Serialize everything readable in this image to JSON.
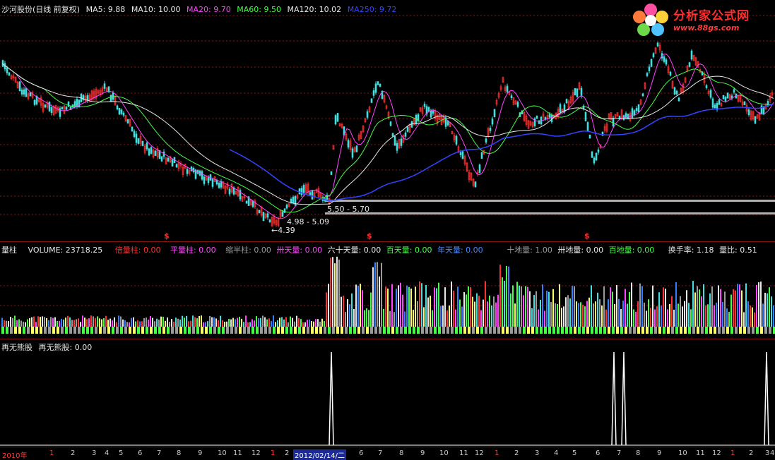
{
  "main": {
    "title": "沙河股份(日线 前复权)",
    "ma": [
      {
        "label": "MA5: 9.88",
        "color": "#e8e8e8"
      },
      {
        "label": "MA10: 10.00",
        "color": "#e8e8e8"
      },
      {
        "label": "MA20: 9.70",
        "color": "#ff44ff"
      },
      {
        "label": "MA60: 9.50",
        "color": "#44ff44"
      },
      {
        "label": "MA120: 10.02",
        "color": "#e8e8e8"
      },
      {
        "label": "MA250: 9.72",
        "color": "#3344ff"
      }
    ],
    "annotation_range_1": "5.50 - 5.70",
    "annotation_range_2": "4.98 - 5.09",
    "annotation_low": "←4.39",
    "dollar_mark": "$"
  },
  "volume": {
    "title": "量柱",
    "items": [
      {
        "label": "VOLUME: 23718.25",
        "color": "#e8e8e8"
      },
      {
        "label": "倍量柱: 0.00",
        "color": "#ff3030"
      },
      {
        "label": "平量柱: 0.00",
        "color": "#ff44ff"
      },
      {
        "label": "缩半柱: 0.00",
        "color": "#9a9a9a"
      },
      {
        "label": "卅天量: 0.00",
        "color": "#ff44ff"
      },
      {
        "label": "六十天量: 0.00",
        "color": "#e8e8e8"
      },
      {
        "label": "百天量: 0.00",
        "color": "#44ff44"
      },
      {
        "label": "年天量: 0.00",
        "color": "#4488ff"
      },
      {
        "label": "十地量: 1.00",
        "color": "#9a9a9a"
      },
      {
        "label": "卅地量: 0.00",
        "color": "#e8e8e8"
      },
      {
        "label": "百地量: 0.00",
        "color": "#44ff44"
      },
      {
        "label": "换手率: 1.18",
        "color": "#e8e8e8"
      },
      {
        "label": "量比: 0.51",
        "color": "#e8e8e8"
      }
    ]
  },
  "indicator": {
    "title": "再无熊股",
    "value_label": "再无熊股: 0.00"
  },
  "time_axis": [
    {
      "label": "2010年",
      "type": "red"
    },
    {
      "label": "1",
      "type": "red"
    },
    {
      "label": "2",
      "type": "normal"
    },
    {
      "label": "3",
      "type": "normal"
    },
    {
      "label": "4",
      "type": "normal"
    },
    {
      "label": "5",
      "type": "normal"
    },
    {
      "label": "6",
      "type": "normal"
    },
    {
      "label": "7",
      "type": "normal"
    },
    {
      "label": "8",
      "type": "normal"
    },
    {
      "label": "9",
      "type": "normal"
    },
    {
      "label": "10",
      "type": "normal"
    },
    {
      "label": "11",
      "type": "normal"
    },
    {
      "label": "12",
      "type": "normal"
    },
    {
      "label": "1",
      "type": "red"
    },
    {
      "label": "2",
      "type": "normal"
    },
    {
      "label": "2012/02/14/二",
      "type": "sel"
    },
    {
      "label": "6",
      "type": "normal"
    },
    {
      "label": "7",
      "type": "normal"
    },
    {
      "label": "8",
      "type": "normal"
    },
    {
      "label": "9",
      "type": "normal"
    },
    {
      "label": "10",
      "type": "normal"
    },
    {
      "label": "11",
      "type": "normal"
    },
    {
      "label": "12",
      "type": "normal"
    },
    {
      "label": "1",
      "type": "red"
    },
    {
      "label": "2",
      "type": "normal"
    },
    {
      "label": "3",
      "type": "normal"
    },
    {
      "label": "4",
      "type": "normal"
    },
    {
      "label": "5",
      "type": "normal"
    },
    {
      "label": "6",
      "type": "normal"
    },
    {
      "label": "7",
      "type": "normal"
    },
    {
      "label": "8",
      "type": "normal"
    },
    {
      "label": "9",
      "type": "normal"
    },
    {
      "label": "10",
      "type": "normal"
    },
    {
      "label": "11",
      "type": "normal"
    },
    {
      "label": "12",
      "type": "normal"
    },
    {
      "label": "1",
      "type": "red"
    },
    {
      "label": "2",
      "type": "normal"
    },
    {
      "label": "3",
      "type": "normal"
    },
    {
      "label": "4",
      "type": "normal"
    }
  ],
  "logo": {
    "text": "分析家公式网",
    "url": "www.88gs.com"
  },
  "colors": {
    "up": "#ff3030",
    "down": "#40e0e0",
    "grid": "#8a1414",
    "ma5": "#e8e8e8",
    "ma20": "#ff44ff",
    "ma60": "#44ff44",
    "ma250": "#3344ff"
  }
}
